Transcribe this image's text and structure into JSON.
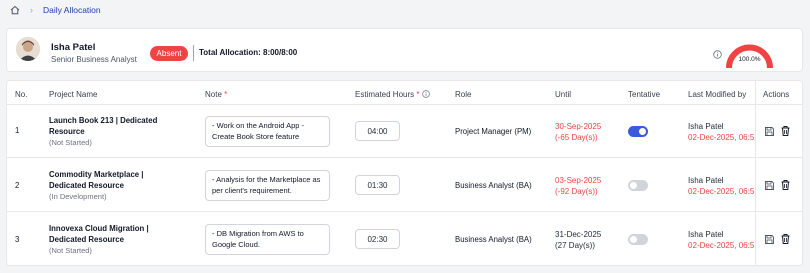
{
  "breadcrumb": {
    "current": "Daily Allocation"
  },
  "employee": {
    "name": "Isha Patel",
    "role": "Senior Business Analyst",
    "status": "Absent",
    "total_allocation": "Total Allocation: 8:00/8:00",
    "gauge_percent": "100.0%",
    "gauge_value": 1.0
  },
  "columns": [
    "No.",
    "Project Name",
    "Note",
    "Estimated Hours",
    "Role",
    "Until",
    "Tentative",
    "Last Modified by",
    "Actions"
  ],
  "rows": [
    {
      "no": "1",
      "project": "Launch Book 213 | Dedicated Resource",
      "project_status": "(Not Started)",
      "note": "- Work on the Android App - Create Book Store feature",
      "hours": "04:00",
      "role": "Project Manager (PM)",
      "until_date": "30-Sep-2025",
      "until_days": "(-65 Day(s))",
      "until_overdue": true,
      "tentative": true,
      "modified_by": "Isha Patel",
      "modified_date": "02-Dec-2025, 06:5"
    },
    {
      "no": "2",
      "project": "Commodity Marketplace | Dedicated Resource",
      "project_status": "(In Development)",
      "note": "- Analysis for the Marketplace as per client's requirement.",
      "hours": "01:30",
      "role": "Business Analyst (BA)",
      "until_date": "03-Sep-2025",
      "until_days": "(-92 Day(s))",
      "until_overdue": true,
      "tentative": false,
      "modified_by": "Isha Patel",
      "modified_date": "02-Dec-2025, 06:5"
    },
    {
      "no": "3",
      "project": "Innovexa Cloud Migration | Dedicated Resource",
      "project_status": "(Not Started)",
      "note": "- DB Migration from AWS to Google Cloud.",
      "hours": "02:30",
      "role": "Business Analyst (BA)",
      "until_date": "31-Dec-2025",
      "until_days": "(27 Day(s))",
      "until_overdue": false,
      "tentative": false,
      "modified_by": "Isha Patel",
      "modified_date": "02-Dec-2025, 06:5"
    }
  ],
  "colors": {
    "accent": "#1e40af",
    "danger": "#ef4444",
    "toggle_on": "#3b5bdb"
  },
  "icons": [
    "home-icon",
    "info-icon",
    "save-icon",
    "trash-icon"
  ]
}
